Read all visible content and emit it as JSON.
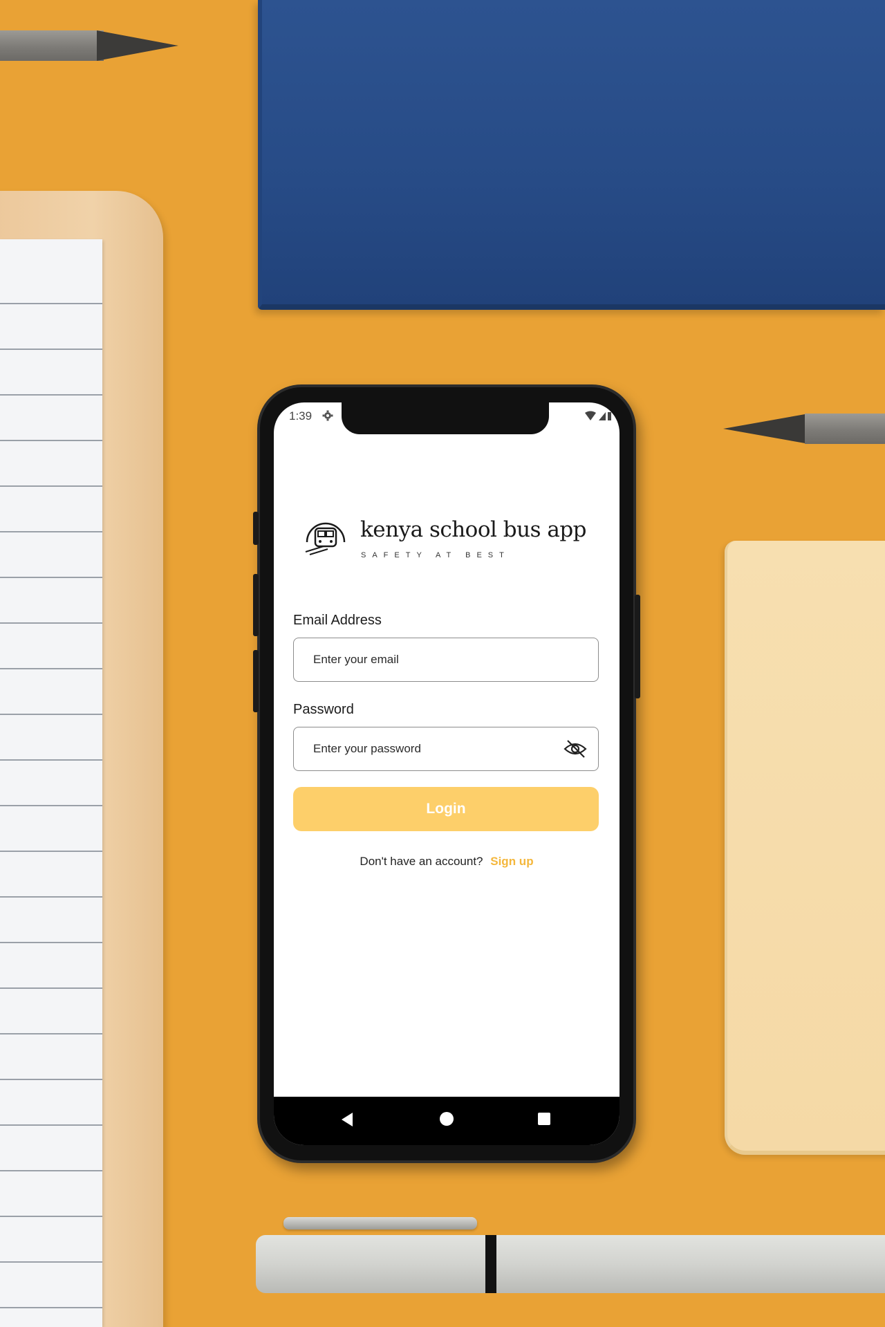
{
  "status_bar": {
    "time": "1:39"
  },
  "app": {
    "title": "kenya school bus app",
    "tagline": "SAFETY AT BEST"
  },
  "form": {
    "email_label": "Email Address",
    "email_placeholder": "Enter your email",
    "password_label": "Password",
    "password_placeholder": "Enter your password",
    "login_label": "Login",
    "signup_prompt": "Don't have an account?",
    "signup_link": "Sign up"
  },
  "colors": {
    "accent": "#f4b73c",
    "login_button": "#fdcf6a",
    "background": "#e9a235"
  },
  "icons": {
    "logo": "bus-logo-icon",
    "password_toggle": "eye-off-icon",
    "settings": "gear-icon",
    "nav_back": "back-triangle-icon",
    "nav_home": "home-circle-icon",
    "nav_recents": "recents-square-icon"
  }
}
